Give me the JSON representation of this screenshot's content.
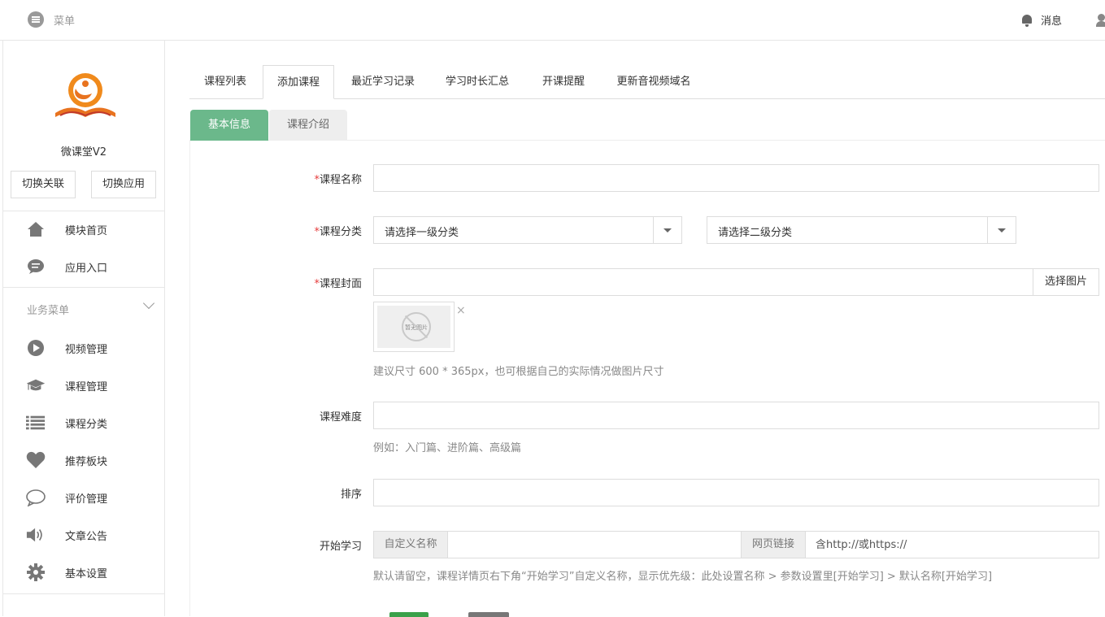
{
  "topbar": {
    "menu_label": "菜单",
    "messages_label": "消息"
  },
  "sidebar": {
    "app_name": "微课堂V2",
    "switch_relation": "切换关联",
    "switch_app": "切换应用",
    "top_items": [
      {
        "label": "模块首页",
        "icon": "home-icon"
      },
      {
        "label": "应用入口",
        "icon": "chat-bubble-icon"
      }
    ],
    "section_title": "业务菜单",
    "items": [
      {
        "label": "视频管理",
        "icon": "play-icon"
      },
      {
        "label": "课程管理",
        "icon": "graduation-cap-icon"
      },
      {
        "label": "课程分类",
        "icon": "list-icon"
      },
      {
        "label": "推荐板块",
        "icon": "heart-icon"
      },
      {
        "label": "评价管理",
        "icon": "comment-icon"
      },
      {
        "label": "文章公告",
        "icon": "speaker-icon"
      },
      {
        "label": "基本设置",
        "icon": "gear-icon"
      }
    ]
  },
  "tabs": [
    "课程列表",
    "添加课程",
    "最近学习记录",
    "学习时长汇总",
    "开课提醒",
    "更新音视频域名"
  ],
  "active_tab": "添加课程",
  "subtabs": [
    "基本信息",
    "课程介绍"
  ],
  "form": {
    "course_name": {
      "label": "课程名称",
      "required": "*",
      "value": ""
    },
    "category": {
      "label": "课程分类",
      "required": "*",
      "level1": "请选择一级分类",
      "level2": "请选择二级分类"
    },
    "cover": {
      "label": "课程封面",
      "required": "*",
      "value": "",
      "button": "选择图片",
      "placeholder_img_text": "暂无图片",
      "remove": "×",
      "help": "建议尺寸 600 * 365px，也可根据自己的实际情况做图片尺寸"
    },
    "difficulty": {
      "label": "课程难度",
      "value": "",
      "help": "例如：入门篇、进阶篇、高级篇"
    },
    "sort": {
      "label": "排序",
      "value": ""
    },
    "start_learning": {
      "label": "开始学习",
      "custom_name_label": "自定义名称",
      "custom_name_value": "",
      "link_label": "网页链接",
      "link_placeholder": "含http://或https://",
      "help": "默认请留空，课程详情页右下角“开始学习”自定义名称，显示优先级：此处设置名称 > 参数设置里[开始学习] > 默认名称[开始学习]"
    }
  },
  "colors": {
    "accent_green": "#6bb88b",
    "required_red": "#e53c3c",
    "logo_orange": "#e8731f"
  }
}
